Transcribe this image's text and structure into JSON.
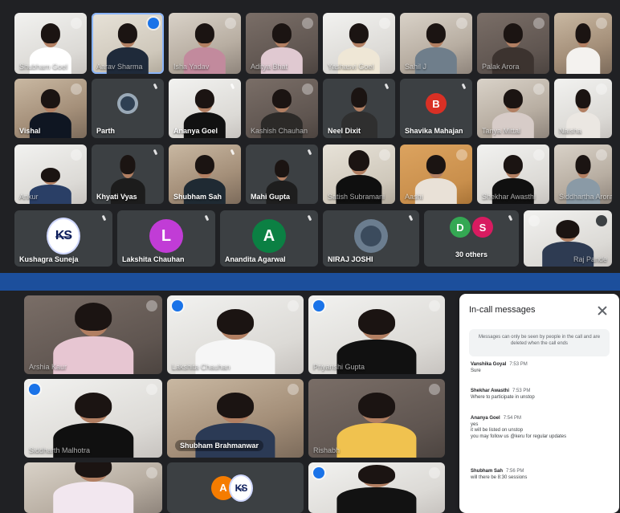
{
  "top_grid": {
    "row1": [
      {
        "name": "Shubham Goel",
        "icon": "mute"
      },
      {
        "name": "Aarav Sharma",
        "icon": "speaking"
      },
      {
        "name": "Isha Yadav",
        "icon": "mute"
      },
      {
        "name": "Aditya Bhat",
        "icon": "mute"
      },
      {
        "name": "Yashasvi Goel",
        "icon": "mute"
      },
      {
        "name": "Sahil J",
        "icon": "mute"
      },
      {
        "name": "Palak Arora",
        "icon": "mute"
      },
      {
        "name": "",
        "icon": "mute"
      }
    ],
    "row2": [
      {
        "name": "Vishal",
        "icon": "mute"
      },
      {
        "name": "Parth",
        "icon": "mic"
      },
      {
        "name": "Ananya Goel",
        "icon": "mic"
      },
      {
        "name": "Kashish Chauhan",
        "icon": "mute"
      },
      {
        "name": "Neel Dixit",
        "icon": "mic"
      },
      {
        "name": "Shavika Mahajan",
        "icon": "mic",
        "avatar": "B"
      },
      {
        "name": "Tanya Mittal",
        "icon": "mute"
      },
      {
        "name": "Naisha",
        "icon": "mute"
      }
    ],
    "row3": [
      {
        "name": "Ankur",
        "icon": "mute"
      },
      {
        "name": "Khyati Vyas",
        "icon": "mic"
      },
      {
        "name": "Shubham Sah",
        "icon": "mic"
      },
      {
        "name": "Mahi Gupta",
        "icon": "mic"
      },
      {
        "name": "Satish Subramani",
        "icon": "mute"
      },
      {
        "name": "Aashi",
        "icon": "mute"
      },
      {
        "name": "Shekhar Awasthi",
        "icon": "mute"
      },
      {
        "name": "Siddhartha Arora",
        "icon": "mute"
      }
    ],
    "row4": [
      {
        "name": "Kushagra Suneja",
        "avatar": "KS",
        "icon": "mic"
      },
      {
        "name": "Lakshita Chauhan",
        "avatar": "L",
        "icon": "mic"
      },
      {
        "name": "Anandita Agarwal",
        "avatar": "A",
        "icon": "mic"
      },
      {
        "name": "NIRAJ JOSHI",
        "icon": "mic"
      },
      {
        "name": "30 others",
        "avatars": [
          "D",
          "S"
        ],
        "icon": "mic"
      },
      {
        "name": "Raj Pande",
        "icon": "mute"
      }
    ]
  },
  "bottom_grid": {
    "tiles": [
      {
        "name": "Arshia Kaur",
        "icon": "mute"
      },
      {
        "name": "Lakshita Chauhan",
        "icon": "speaking"
      },
      {
        "name": "Priyanshi Gupta",
        "icon": "speaking"
      },
      {
        "name": "Siddharth Malhotra",
        "icon": "speaking"
      },
      {
        "name": "Shubham Brahmanwar",
        "icon": "mute"
      },
      {
        "name": "Rishabh",
        "icon": "mute"
      },
      {
        "name": "",
        "icon": "mute"
      },
      {
        "name": "",
        "avatars": [
          "A",
          "KS"
        ],
        "icon": ""
      },
      {
        "name": "",
        "icon": "speaking"
      }
    ]
  },
  "chat": {
    "title": "In-call messages",
    "note": "Messages can only be seen by people in the call and are deleted when the call ends",
    "messages": [
      {
        "sender": "Vanshika Goyal",
        "time": "7:53 PM",
        "text": "Sure"
      },
      {
        "sender": "Shekhar Awasthi",
        "time": "7:53 PM",
        "text": "Where to participate in unstop"
      },
      {
        "sender": "Ananya Goel",
        "time": "7:54 PM",
        "text": "yes\nit will be listed on unstop\nyou may follow us @keru for regular updates"
      },
      {
        "sender": "Shubham Sah",
        "time": "7:56 PM",
        "text": "will there be 8:30 sessions"
      }
    ]
  }
}
